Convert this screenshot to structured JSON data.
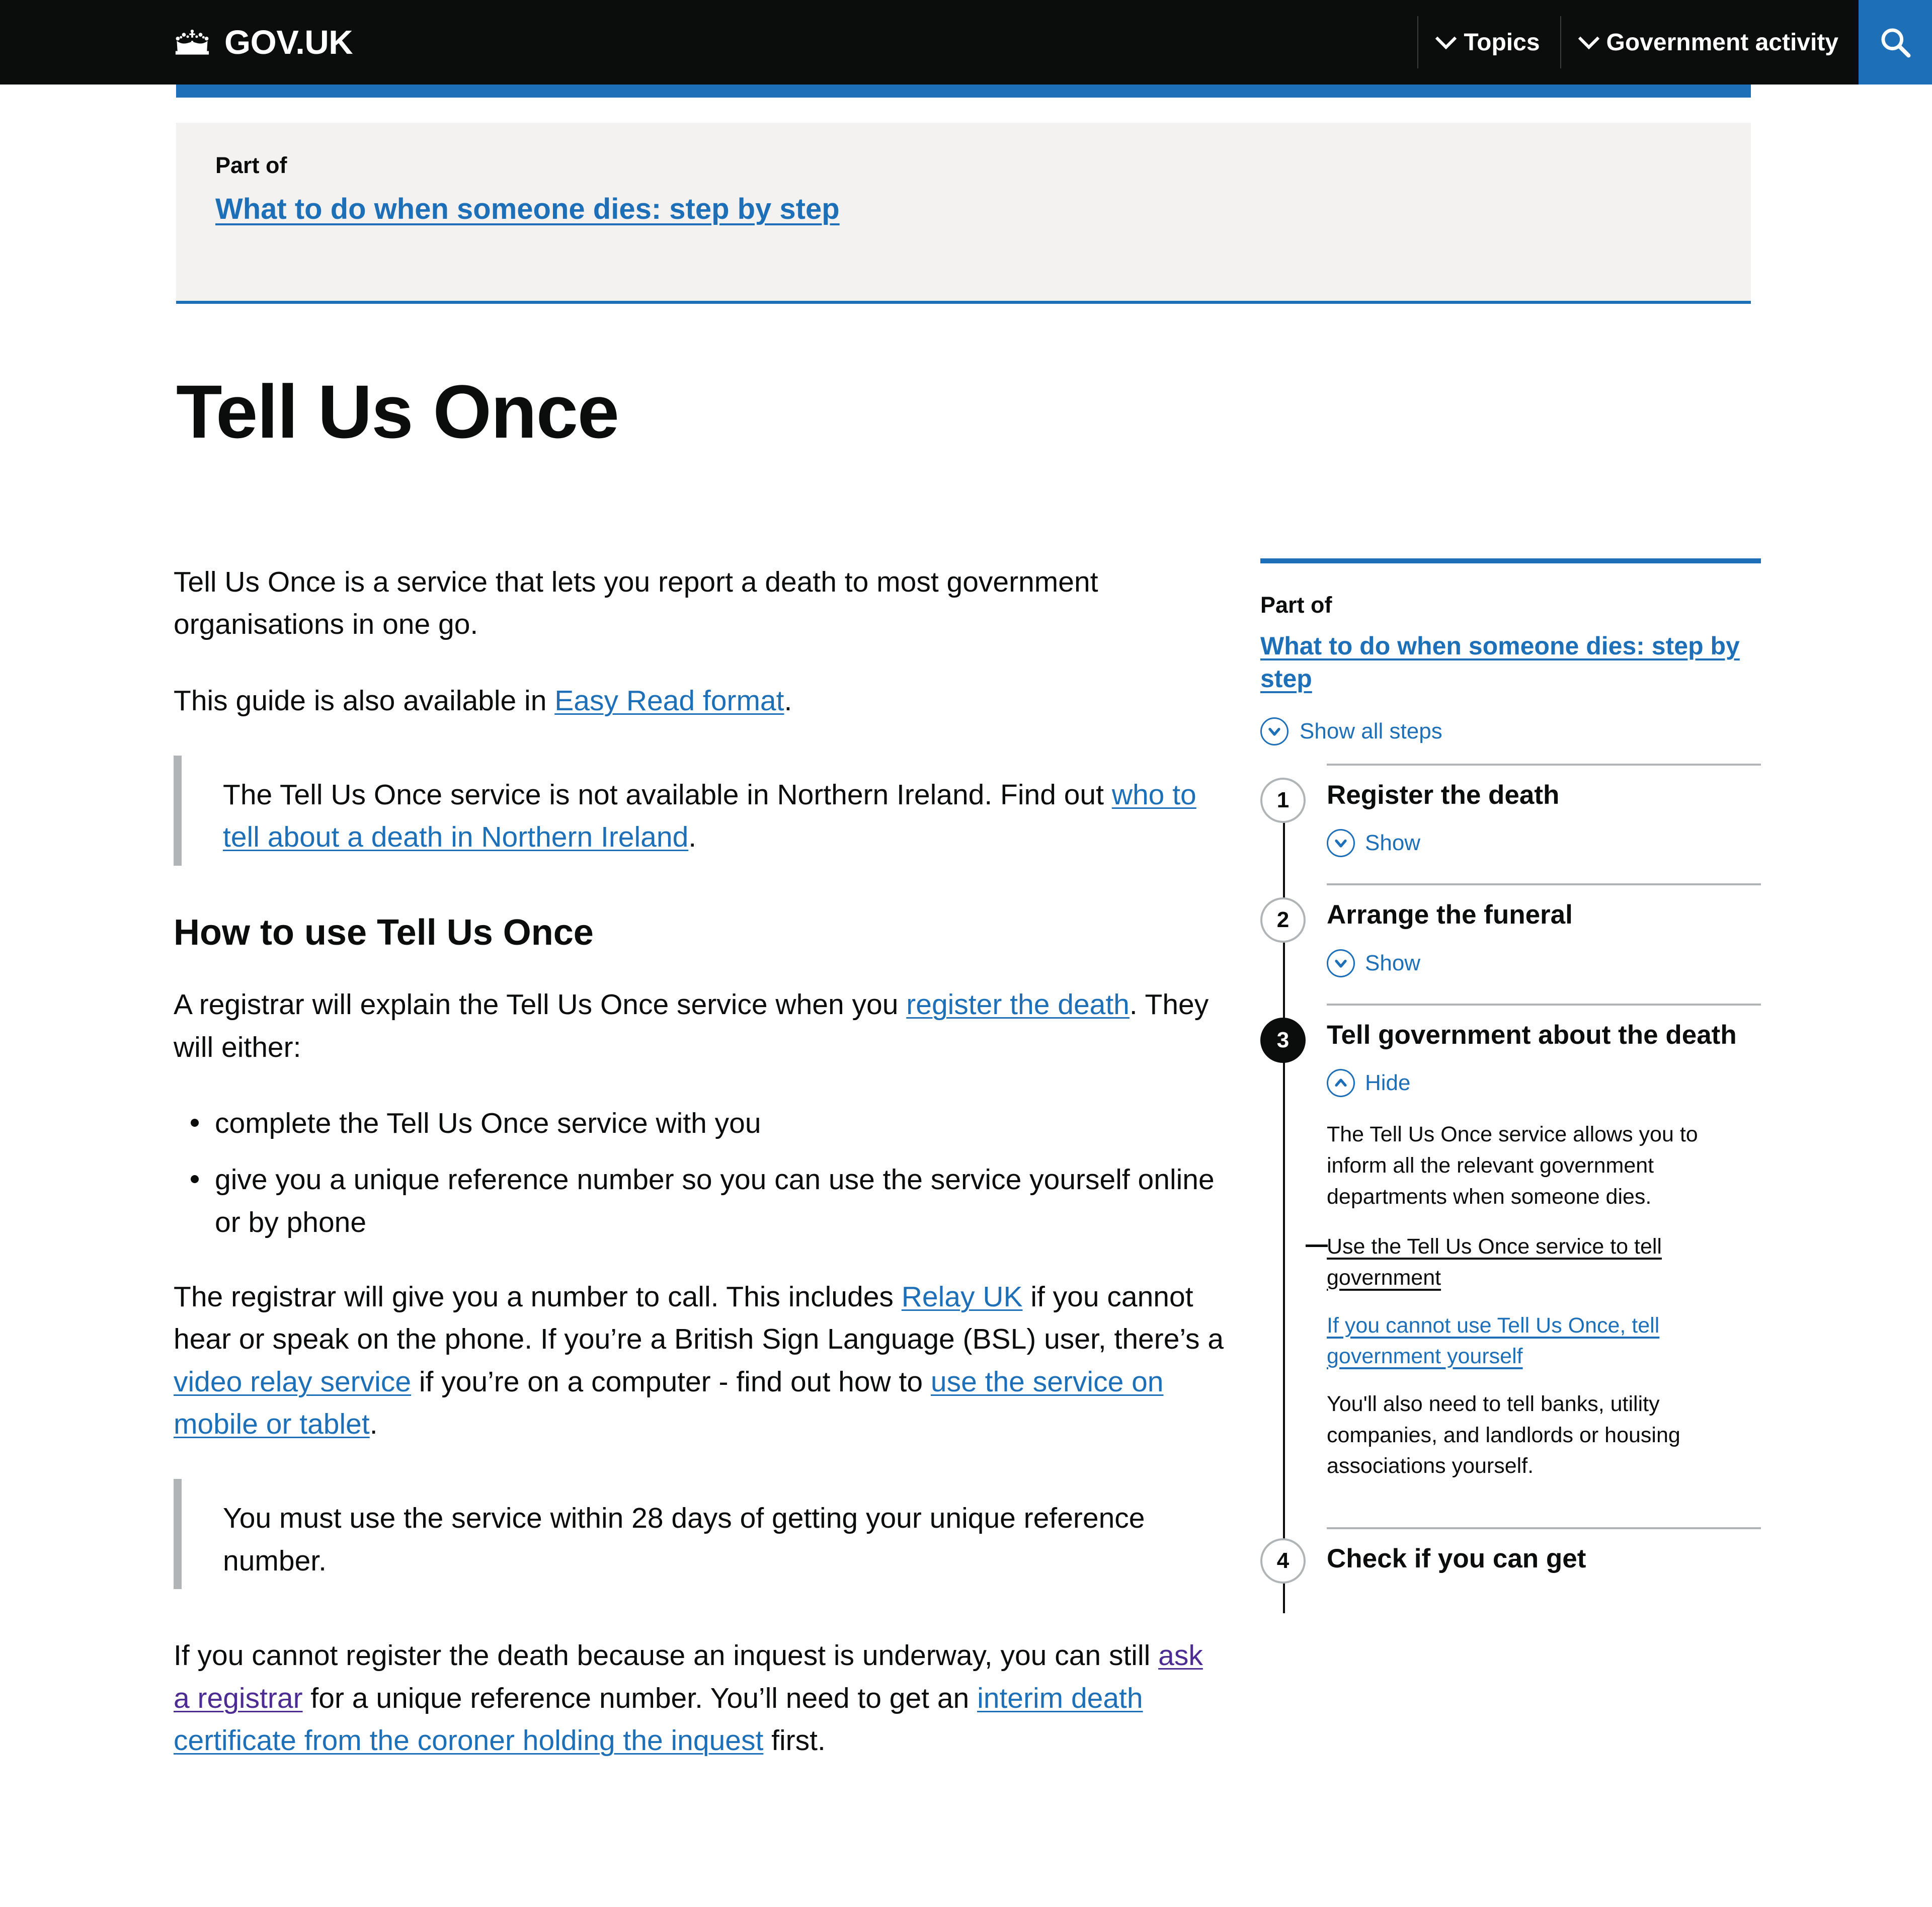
{
  "header": {
    "brand": "GOV.UK",
    "nav": [
      {
        "label": "Topics"
      },
      {
        "label": "Government activity"
      }
    ]
  },
  "banner": {
    "part_of_label": "Part of",
    "part_of_link": "What to do when someone dies: step by step"
  },
  "page": {
    "title": "Tell Us Once"
  },
  "main": {
    "intro": "Tell Us Once is a service that lets you report a death to most government organisations in one go.",
    "easy_read_before": "This guide is also available in ",
    "easy_read_link": "Easy Read format",
    "easy_read_after": ".",
    "ni_inset_before": "The Tell Us Once service is not available in Northern Ireland. Find out ",
    "ni_inset_link": "who to tell about a death in Northern Ireland",
    "ni_inset_after": ".",
    "how_to_heading": "How to use Tell Us Once",
    "registrar_before": "A registrar will explain the Tell Us Once service when you ",
    "registrar_link": "register the death",
    "registrar_after": ". They will either:",
    "bullets": [
      "complete the Tell Us Once service with you",
      "give you a unique reference number so you can use the service yourself online or by phone"
    ],
    "relay_p1": "The registrar will give you a number to call. This includes ",
    "relay_link1": "Relay UK",
    "relay_p2": " if you cannot hear or speak on the phone. If you’re a British Sign Language (BSL) user, there’s a ",
    "relay_link2": "video relay service",
    "relay_p3": " if you’re on a computer - find out how to ",
    "relay_link3": "use the service on mobile or tablet",
    "relay_p4": ".",
    "days_inset": "You must use the service within 28 days of getting your unique reference number.",
    "inquest_p1": "If you cannot register the death because an inquest is underway, you can still ",
    "inquest_link1": "ask a registrar",
    "inquest_p2": " for a unique reference number. You’ll need to get an ",
    "inquest_link2": "interim death certificate from the coroner holding the inquest",
    "inquest_p3": " first."
  },
  "sidebar": {
    "part_of_label": "Part of",
    "part_of_link": "What to do when someone dies: step by step",
    "show_all_label": "Show all steps",
    "steps": [
      {
        "number": "1",
        "title": "Register the death",
        "toggle_label": "Show",
        "toggle_state": "collapsed",
        "active": false
      },
      {
        "number": "2",
        "title": "Arrange the funeral",
        "toggle_label": "Show",
        "toggle_state": "collapsed",
        "active": false
      },
      {
        "number": "3",
        "title": "Tell government about the death",
        "toggle_label": "Hide",
        "toggle_state": "expanded",
        "active": true,
        "panel": {
          "intro": "The Tell Us Once service allows you to inform all the relevant government departments when someone dies.",
          "current_link": "Use the Tell Us Once service to tell government",
          "other_link": "If you cannot use Tell Us Once, tell government yourself",
          "outro": "You'll also need to tell banks, utility companies, and landlords or housing associations yourself."
        }
      },
      {
        "number": "4",
        "title": "Check if you can get",
        "active": false,
        "cut_off": true
      }
    ]
  },
  "colors": {
    "brand_black": "#0b0c0c",
    "link_blue": "#1d70b8",
    "visited_purple": "#4c2c92",
    "banner_grey": "#f3f2f1",
    "border_grey": "#b1b4b6"
  }
}
